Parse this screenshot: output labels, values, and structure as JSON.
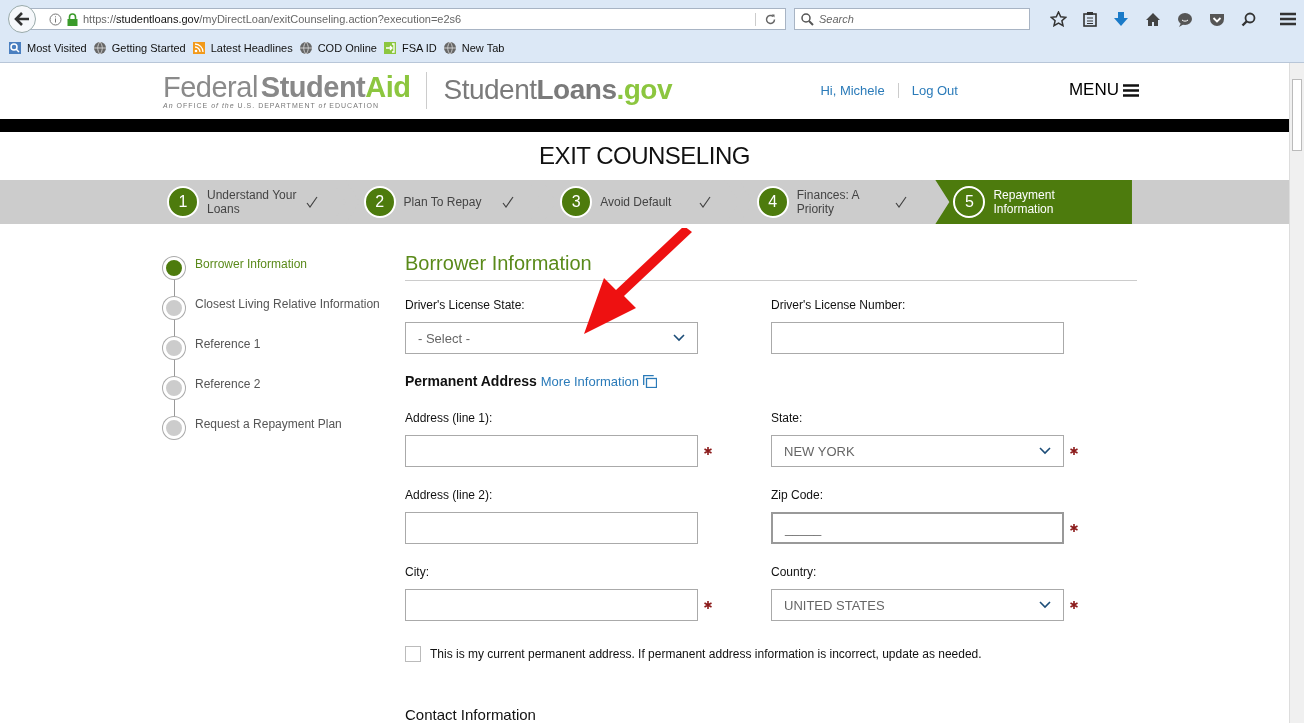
{
  "browser": {
    "url": "https://**studentloans.gov**/myDirectLoan/exitCounseling.action?execution=e2s6",
    "search": {
      "placeholder": "Search"
    },
    "bookmarks": [
      {
        "label": "Most Visited",
        "kind": "folder"
      },
      {
        "label": "Getting Started",
        "kind": "globe"
      },
      {
        "label": "Latest Headlines",
        "kind": "feed"
      },
      {
        "label": "COD Online",
        "kind": "globe"
      },
      {
        "label": "FSA ID",
        "kind": "login"
      },
      {
        "label": "New Tab",
        "kind": "globe"
      }
    ]
  },
  "header": {
    "logo": [
      "Federal",
      "Student",
      "Aid"
    ],
    "tagline": "*An* OFFICE *of the* U.S. DEPARTMENT *of* EDUCATION",
    "site": [
      "Student",
      "Loans",
      ".gov"
    ],
    "greeting": "Hi, Michele",
    "logout": "Log Out",
    "menu": "MENU"
  },
  "title": "EXIT COUNSELING",
  "steps": [
    {
      "number": "1",
      "label": "Understand Your Loans",
      "completed": true,
      "selected": false
    },
    {
      "number": "2",
      "label": "Plan To Repay",
      "completed": true,
      "selected": false
    },
    {
      "number": "3",
      "label": "Avoid Default",
      "completed": true,
      "selected": false
    },
    {
      "number": "4",
      "label": "Finances: A Priority",
      "completed": true,
      "selected": false
    },
    {
      "number": "5",
      "label": "Repayment Information",
      "completed": false,
      "selected": true
    }
  ],
  "side_nav": [
    {
      "label": "Borrower Information",
      "selected": true
    },
    {
      "label": "Closest Living Relative Information",
      "selected": false
    },
    {
      "label": "Reference 1",
      "selected": false
    },
    {
      "label": "Reference 2",
      "selected": false
    },
    {
      "label": "Request a Repayment Plan",
      "selected": false
    }
  ],
  "section_title": "Borrower Information",
  "license_fields": [
    {
      "label": "Driver's License State:",
      "kind": "select",
      "value": "- Select -",
      "required": false,
      "focused": false
    },
    {
      "label": "Driver's License Number:",
      "kind": "text",
      "required": false,
      "focused": false
    }
  ],
  "address_heading": {
    "title": "Permanent Address",
    "link": "More Information"
  },
  "address_fields": [
    {
      "label": "Address (line 1):",
      "kind": "text",
      "required": true,
      "focused": false
    },
    {
      "label": "State:",
      "kind": "select",
      "value": "NEW YORK",
      "required": true,
      "focused": false
    },
    {
      "label": "Address (line 2):",
      "kind": "text",
      "required": false,
      "focused": false
    },
    {
      "label": "Zip Code:",
      "kind": "text",
      "value": "_____",
      "required": true,
      "focused": true
    },
    {
      "label": "City:",
      "kind": "text",
      "required": true,
      "focused": false
    },
    {
      "label": "Country:",
      "kind": "select",
      "value": "UNITED STATES",
      "required": true,
      "focused": false
    }
  ],
  "current_address": {
    "label": "This is my current permanent address. If permanent address information is incorrect, update as needed.",
    "checked": false
  },
  "contact_heading": "Contact Information"
}
